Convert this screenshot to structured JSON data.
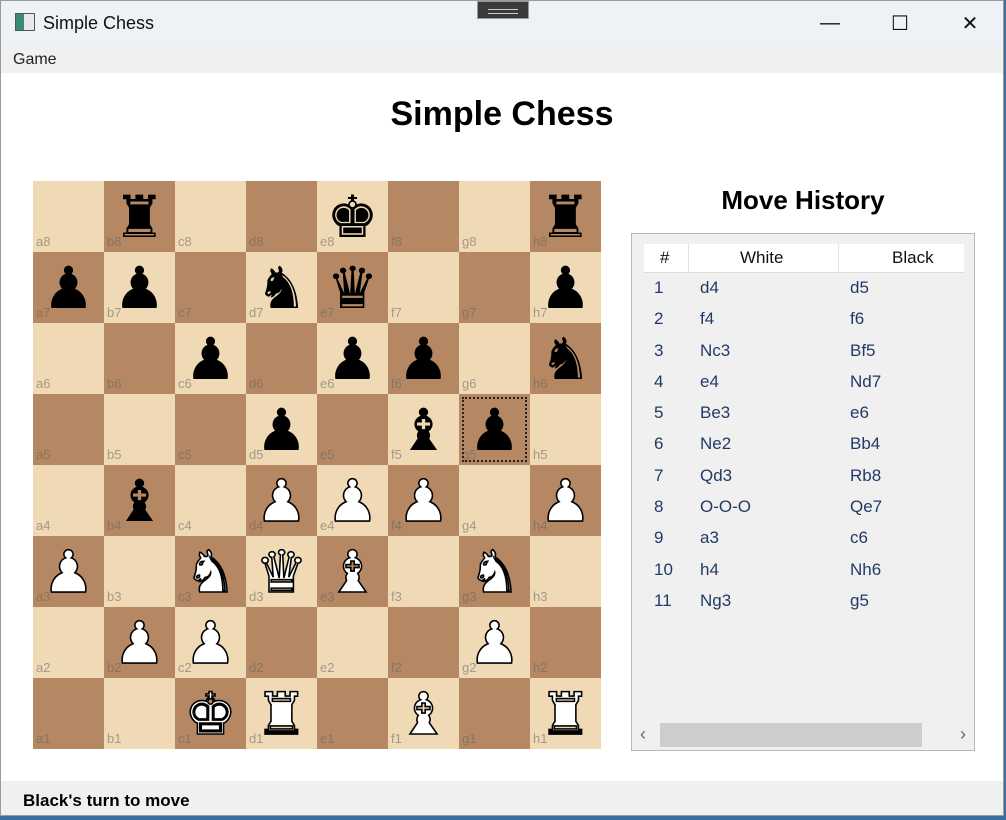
{
  "window": {
    "title": "Simple Chess",
    "minimize_glyph": "—",
    "maximize_glyph": "☐",
    "close_glyph": "✕"
  },
  "menu": {
    "game": "Game"
  },
  "heading": "Simple Chess",
  "board": {
    "files": [
      "a",
      "b",
      "c",
      "d",
      "e",
      "f",
      "g",
      "h"
    ],
    "ranks": [
      "8",
      "7",
      "6",
      "5",
      "4",
      "3",
      "2",
      "1"
    ],
    "selected_square": "g5",
    "light_color": "#f0d9b5",
    "dark_color": "#b58863",
    "pieces": [
      {
        "square": "b8",
        "color": "black",
        "type": "rook"
      },
      {
        "square": "e8",
        "color": "black",
        "type": "king"
      },
      {
        "square": "h8",
        "color": "black",
        "type": "rook"
      },
      {
        "square": "a7",
        "color": "black",
        "type": "pawn"
      },
      {
        "square": "b7",
        "color": "black",
        "type": "pawn"
      },
      {
        "square": "d7",
        "color": "black",
        "type": "knight"
      },
      {
        "square": "e7",
        "color": "black",
        "type": "queen"
      },
      {
        "square": "h7",
        "color": "black",
        "type": "pawn"
      },
      {
        "square": "c6",
        "color": "black",
        "type": "pawn"
      },
      {
        "square": "e6",
        "color": "black",
        "type": "pawn"
      },
      {
        "square": "f6",
        "color": "black",
        "type": "pawn"
      },
      {
        "square": "h6",
        "color": "black",
        "type": "knight"
      },
      {
        "square": "d5",
        "color": "black",
        "type": "pawn"
      },
      {
        "square": "f5",
        "color": "black",
        "type": "bishop"
      },
      {
        "square": "g5",
        "color": "black",
        "type": "pawn"
      },
      {
        "square": "b4",
        "color": "black",
        "type": "bishop"
      },
      {
        "square": "d4",
        "color": "white",
        "type": "pawn"
      },
      {
        "square": "e4",
        "color": "white",
        "type": "pawn"
      },
      {
        "square": "f4",
        "color": "white",
        "type": "pawn"
      },
      {
        "square": "h4",
        "color": "white",
        "type": "pawn"
      },
      {
        "square": "a3",
        "color": "white",
        "type": "pawn"
      },
      {
        "square": "c3",
        "color": "white",
        "type": "knight"
      },
      {
        "square": "d3",
        "color": "white",
        "type": "queen"
      },
      {
        "square": "e3",
        "color": "white",
        "type": "bishop"
      },
      {
        "square": "g3",
        "color": "white",
        "type": "knight"
      },
      {
        "square": "b2",
        "color": "white",
        "type": "pawn"
      },
      {
        "square": "c2",
        "color": "white",
        "type": "pawn"
      },
      {
        "square": "g2",
        "color": "white",
        "type": "pawn"
      },
      {
        "square": "c1",
        "color": "white",
        "type": "king"
      },
      {
        "square": "d1",
        "color": "white",
        "type": "rook"
      },
      {
        "square": "f1",
        "color": "white",
        "type": "bishop"
      },
      {
        "square": "h1",
        "color": "white",
        "type": "rook"
      }
    ]
  },
  "history": {
    "title": "Move History",
    "columns": [
      "#",
      "White",
      "Black"
    ],
    "moves": [
      {
        "n": "1",
        "white": "d4",
        "black": "d5"
      },
      {
        "n": "2",
        "white": "f4",
        "black": "f6"
      },
      {
        "n": "3",
        "white": "Nc3",
        "black": "Bf5"
      },
      {
        "n": "4",
        "white": "e4",
        "black": "Nd7"
      },
      {
        "n": "5",
        "white": "Be3",
        "black": "e6"
      },
      {
        "n": "6",
        "white": "Ne2",
        "black": "Bb4"
      },
      {
        "n": "7",
        "white": "Qd3",
        "black": "Rb8"
      },
      {
        "n": "8",
        "white": "O-O-O",
        "black": "Qe7"
      },
      {
        "n": "9",
        "white": "a3",
        "black": "c6"
      },
      {
        "n": "10",
        "white": "h4",
        "black": "Nh6"
      },
      {
        "n": "11",
        "white": "Ng3",
        "black": "g5"
      }
    ],
    "scroll_left_glyph": "‹",
    "scroll_right_glyph": "›"
  },
  "status": "Black's turn to move"
}
